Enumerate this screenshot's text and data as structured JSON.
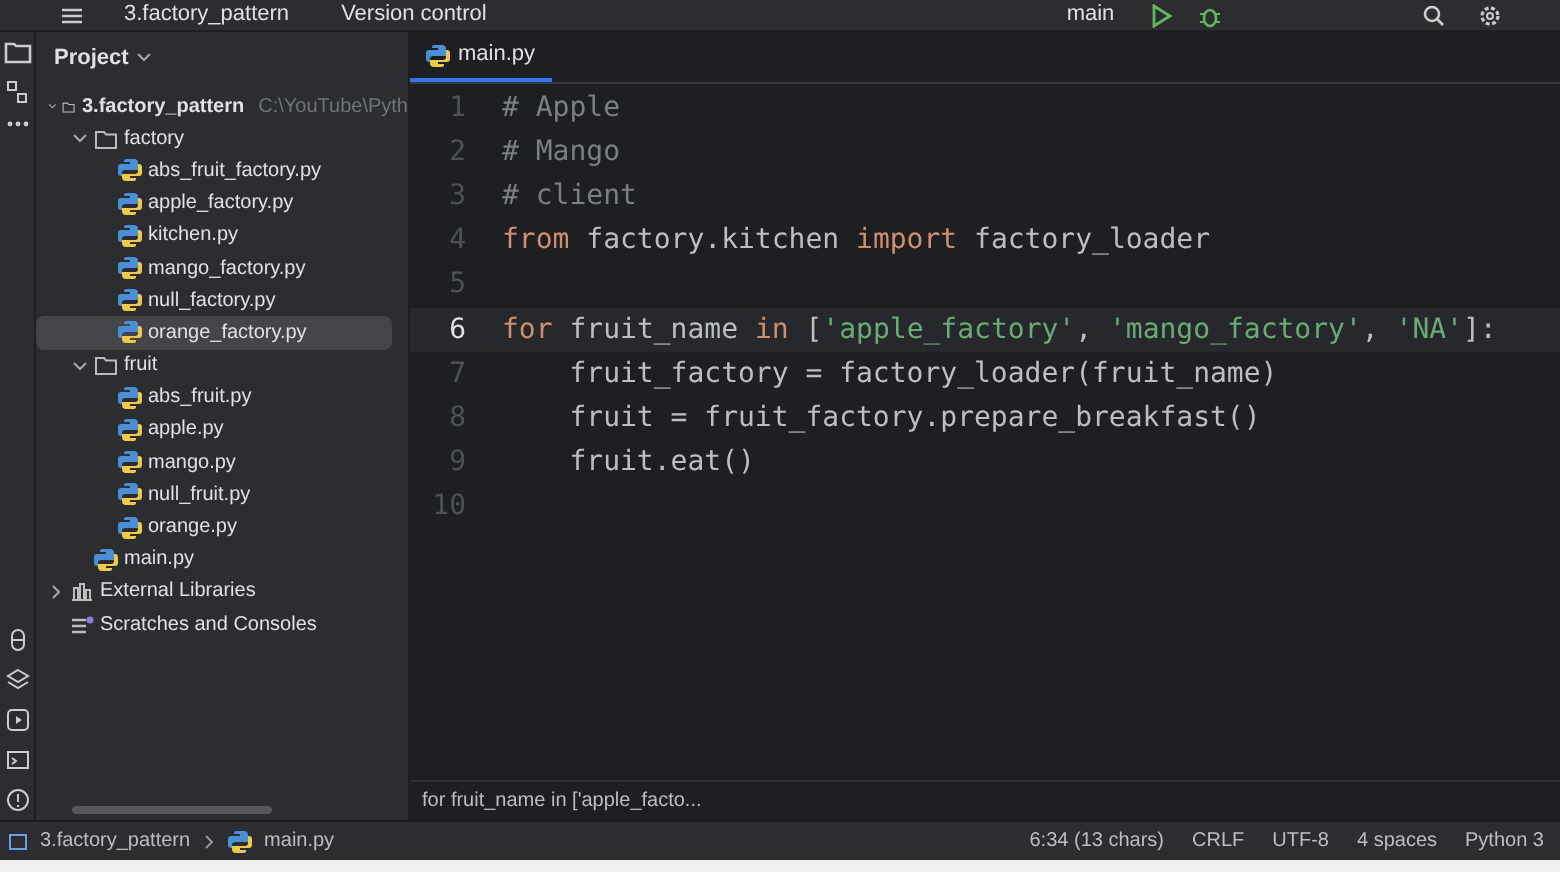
{
  "toolbar": {
    "project": "3.factory_pattern",
    "vcs": "Version control",
    "branch": "main"
  },
  "project_panel": {
    "title": "Project",
    "tree": [
      {
        "label": "3.factory_pattern",
        "path": "C:\\YouTube\\Pyth",
        "kind": "folder",
        "expanded": true,
        "selected": false,
        "children": [
          {
            "label": "factory",
            "kind": "folder",
            "expanded": true,
            "selected": false,
            "children": [
              {
                "label": "abs_fruit_factory.py",
                "kind": "py",
                "selected": false
              },
              {
                "label": "apple_factory.py",
                "kind": "py",
                "selected": false
              },
              {
                "label": "kitchen.py",
                "kind": "py",
                "selected": false
              },
              {
                "label": "mango_factory.py",
                "kind": "py",
                "selected": false
              },
              {
                "label": "null_factory.py",
                "kind": "py",
                "selected": false
              },
              {
                "label": "orange_factory.py",
                "kind": "py",
                "selected": true
              }
            ]
          },
          {
            "label": "fruit",
            "kind": "folder",
            "expanded": true,
            "selected": false,
            "children": [
              {
                "label": "abs_fruit.py",
                "kind": "py",
                "selected": false
              },
              {
                "label": "apple.py",
                "kind": "py",
                "selected": false
              },
              {
                "label": "mango.py",
                "kind": "py",
                "selected": false
              },
              {
                "label": "null_fruit.py",
                "kind": "py",
                "selected": false
              },
              {
                "label": "orange.py",
                "kind": "py",
                "selected": false
              }
            ]
          },
          {
            "label": "main.py",
            "kind": "py",
            "selected": false
          }
        ]
      },
      {
        "label": "External Libraries",
        "kind": "library",
        "expanded": false,
        "selected": false
      },
      {
        "label": "Scratches and Consoles",
        "kind": "scratch",
        "selected": false
      }
    ]
  },
  "editor": {
    "tabs": [
      {
        "label": "main.py",
        "selected": true
      }
    ],
    "lines": [
      {
        "number": "1",
        "current": false,
        "tokens": [
          {
            "kind": "comment",
            "text": "# Apple"
          }
        ]
      },
      {
        "number": "2",
        "current": false,
        "tokens": [
          {
            "kind": "comment",
            "text": "# Mango"
          }
        ]
      },
      {
        "number": "3",
        "current": false,
        "tokens": [
          {
            "kind": "comment",
            "text": "# client"
          }
        ]
      },
      {
        "number": "4",
        "current": false,
        "tokens": [
          {
            "kind": "keyword",
            "text": "from"
          },
          {
            "kind": "plain",
            "text": " factory.kitchen "
          },
          {
            "kind": "keyword",
            "text": "import"
          },
          {
            "kind": "plain",
            "text": " factory_loader"
          }
        ]
      },
      {
        "number": "5",
        "current": false
      },
      {
        "number": "6",
        "current": true,
        "tokens": [
          {
            "kind": "keyword",
            "text": "for"
          },
          {
            "kind": "plain",
            "text": " fruit_name "
          },
          {
            "kind": "keyword",
            "text": "in"
          },
          {
            "kind": "plain",
            "text": " ["
          },
          {
            "kind": "string",
            "text": "'apple_factory'"
          },
          {
            "kind": "plain",
            "text": ", "
          },
          {
            "kind": "string",
            "text": "'mango_factory'"
          },
          {
            "kind": "plain",
            "text": ", "
          },
          {
            "kind": "string",
            "text": "'NA'"
          },
          {
            "kind": "plain",
            "text": "]:"
          }
        ]
      },
      {
        "number": "7",
        "current": false,
        "tokens": [
          {
            "kind": "plain",
            "text": "    fruit_factory = factory_loader(fruit_name)"
          }
        ]
      },
      {
        "number": "8",
        "current": false,
        "tokens": [
          {
            "kind": "plain",
            "text": "    fruit = fruit_factory.prepare_breakfast()"
          }
        ]
      },
      {
        "number": "9",
        "current": false,
        "tokens": [
          {
            "kind": "plain",
            "text": "    fruit.eat()"
          }
        ]
      },
      {
        "number": "10",
        "current": false
      }
    ],
    "sticky_hint": "for fruit_name in ['apple_facto..."
  },
  "status_bar": {
    "breadcrumbs": [
      "3.factory_pattern",
      "main.py"
    ],
    "items": [
      "6:34 (13 chars)",
      "CRLF",
      "UTF-8",
      "4 spaces",
      "Python 3"
    ]
  }
}
